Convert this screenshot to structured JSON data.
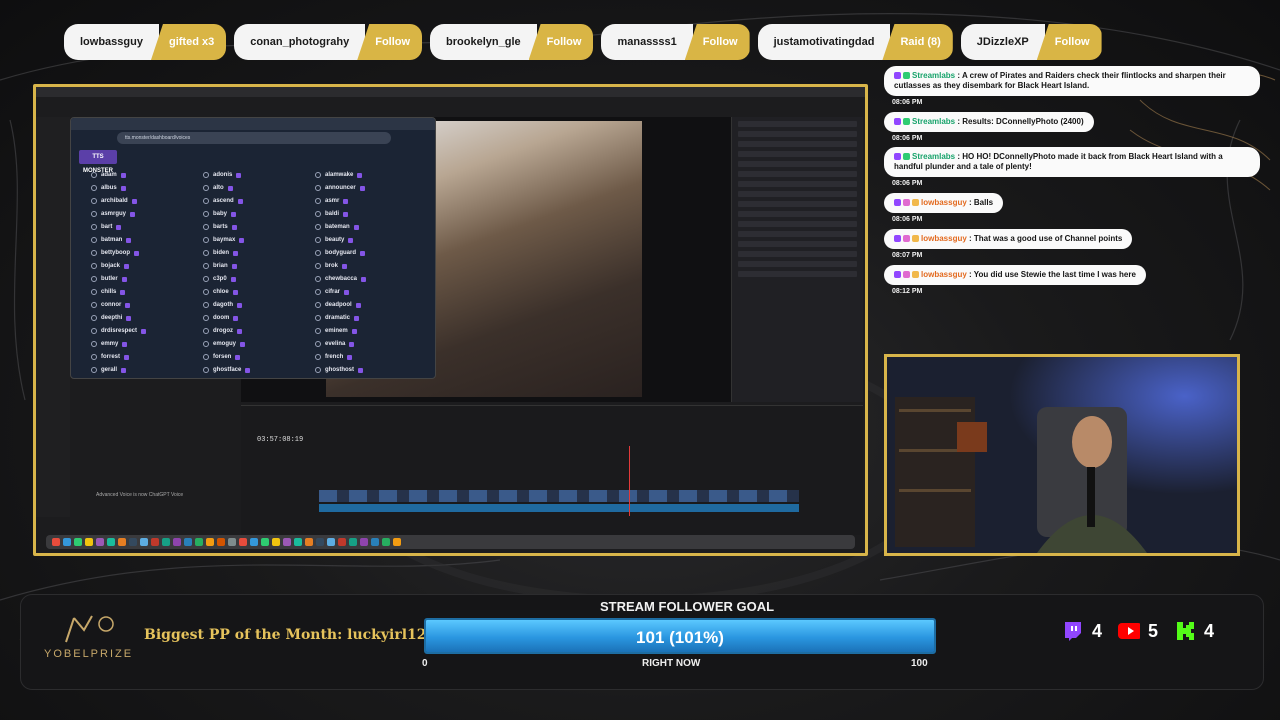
{
  "events": [
    {
      "user": "lowbassguy",
      "action": "gifted x3"
    },
    {
      "user": "conan_photograhy",
      "action": "Follow"
    },
    {
      "user": "brookelyn_gle",
      "action": "Follow"
    },
    {
      "user": "manassss1",
      "action": "Follow"
    },
    {
      "user": "justamotivatingdad",
      "action": "Raid (8)"
    },
    {
      "user": "JDizzleXP",
      "action": "Follow"
    }
  ],
  "screen": {
    "browser_address": "tts.monster/dashboard/voices",
    "logo_text": "TTS MONSTER",
    "timecode": "03:57:08:19",
    "caption_hint": "Advanced Voice is now ChatGPT Voice",
    "voices": [
      "adam",
      "adonis",
      "alamwake",
      "albus",
      "alto",
      "announcer",
      "archibald",
      "ascend",
      "asmr",
      "asmrguy",
      "baby",
      "baldi",
      "bart",
      "barts",
      "bateman",
      "batman",
      "baymax",
      "beauty",
      "bettyboop",
      "biden",
      "bodyguard",
      "bojack",
      "brian",
      "brok",
      "butler",
      "c3p0",
      "chewbacca",
      "chills",
      "chloe",
      "cifrar",
      "connor",
      "dagoth",
      "deadpool",
      "deepthi",
      "doom",
      "dramatic",
      "drdisrespect",
      "drogoz",
      "eminem",
      "emmy",
      "emoguy",
      "evelina",
      "forrest",
      "forsen",
      "french",
      "gerall",
      "ghostface",
      "ghosthost"
    ]
  },
  "chat": [
    {
      "user": "Streamlabs",
      "kind": "bot",
      "text": "A crew of Pirates and Raiders check their flintlocks and sharpen their cutlasses as they disembark for Black Heart Island.",
      "time": "08:06 PM"
    },
    {
      "user": "Streamlabs",
      "kind": "bot",
      "text": "Results: DConnellyPhoto (2400)",
      "time": "08:06 PM"
    },
    {
      "user": "Streamlabs",
      "kind": "bot",
      "text": "HO HO! DConnellyPhoto made it back from Black Heart Island with a handful plunder and a tale of plenty!",
      "time": "08:06 PM"
    },
    {
      "user": "lowbassguy",
      "kind": "viewer",
      "text": "Balls",
      "time": "08:06 PM"
    },
    {
      "user": "lowbassguy",
      "kind": "viewer",
      "text": "That was a good use of Channel points",
      "time": "08:07 PM"
    },
    {
      "user": "lowbassguy",
      "kind": "viewer",
      "text": "You did use Stewie the last time I was here",
      "time": "08:12 PM"
    }
  ],
  "brand": {
    "name": "YOBELPRIZE"
  },
  "pp_of_month": "Biggest PP of the Month: luckyirl123",
  "goal": {
    "title": "STREAM FOLLOWER GOAL",
    "value_text": "101 (101%)",
    "progress": 1.0,
    "min": "0",
    "max": "100",
    "subtitle": "RIGHT NOW"
  },
  "counts": [
    {
      "platform": "twitch",
      "value": "4",
      "color": "#9146ff"
    },
    {
      "platform": "youtube",
      "value": "5",
      "color": "#ff0000"
    },
    {
      "platform": "kick",
      "value": "4",
      "color": "#53fc18"
    }
  ],
  "colors": {
    "gold": "#d8b54a",
    "goal_blue": "#2a96e0"
  }
}
